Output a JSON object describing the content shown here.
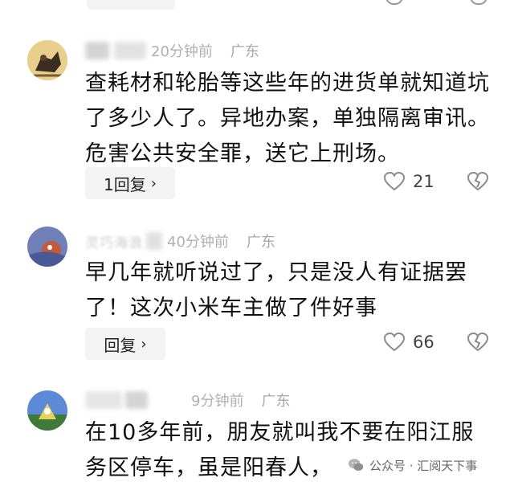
{
  "comments": [
    {
      "nickname": "",
      "time": "20分钟前",
      "location": "广东",
      "text": "查耗材和轮胎等这些年的进货单就知道坑了多少人了。异地办案，单独隔离审讯。危害公共安全罪，送它上刑场。",
      "reply_label": "1回复",
      "likes": "21"
    },
    {
      "nickname": "灵巧海浪",
      "time": "40分钟前",
      "location": "广东",
      "text": "早几年就听说过了，只是没人有证据罢了！这次小米车主做了件好事",
      "reply_label": "回复",
      "likes": "66"
    },
    {
      "nickname": "",
      "time": "9分钟前",
      "location": "广东",
      "text": "在10多年前，朋友就叫我不要在阳江服务区停车，虽是阳春人，"
    }
  ],
  "watermark": {
    "text": "公众号 · 汇阅天下事"
  },
  "icons": {
    "like": "heart-icon",
    "dislike": "broken-heart-icon",
    "reply_more": "chevron-right-icon",
    "watermark": "wechat-icon"
  },
  "colors": {
    "text": "#111111",
    "meta": "#b0b0b0",
    "button_bg": "#f3f3f3",
    "icon": "#8a8a8a"
  }
}
